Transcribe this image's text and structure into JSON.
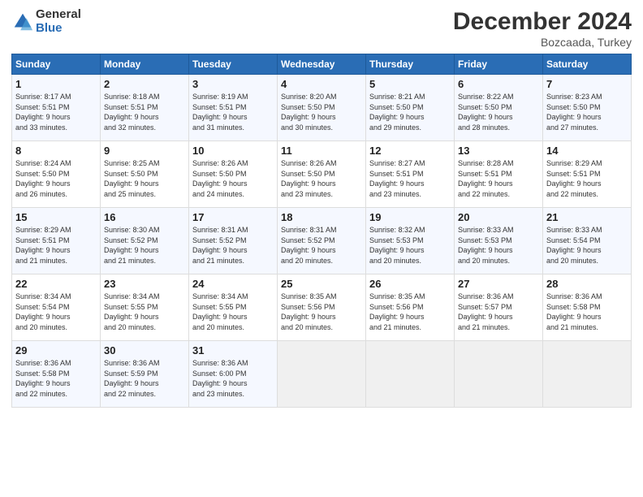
{
  "header": {
    "logo_general": "General",
    "logo_blue": "Blue",
    "title": "December 2024",
    "location": "Bozcaada, Turkey"
  },
  "columns": [
    "Sunday",
    "Monday",
    "Tuesday",
    "Wednesday",
    "Thursday",
    "Friday",
    "Saturday"
  ],
  "weeks": [
    {
      "cells": [
        {
          "day": "1",
          "info": "Sunrise: 8:17 AM\nSunset: 5:51 PM\nDaylight: 9 hours\nand 33 minutes."
        },
        {
          "day": "2",
          "info": "Sunrise: 8:18 AM\nSunset: 5:51 PM\nDaylight: 9 hours\nand 32 minutes."
        },
        {
          "day": "3",
          "info": "Sunrise: 8:19 AM\nSunset: 5:51 PM\nDaylight: 9 hours\nand 31 minutes."
        },
        {
          "day": "4",
          "info": "Sunrise: 8:20 AM\nSunset: 5:50 PM\nDaylight: 9 hours\nand 30 minutes."
        },
        {
          "day": "5",
          "info": "Sunrise: 8:21 AM\nSunset: 5:50 PM\nDaylight: 9 hours\nand 29 minutes."
        },
        {
          "day": "6",
          "info": "Sunrise: 8:22 AM\nSunset: 5:50 PM\nDaylight: 9 hours\nand 28 minutes."
        },
        {
          "day": "7",
          "info": "Sunrise: 8:23 AM\nSunset: 5:50 PM\nDaylight: 9 hours\nand 27 minutes."
        }
      ]
    },
    {
      "cells": [
        {
          "day": "8",
          "info": "Sunrise: 8:24 AM\nSunset: 5:50 PM\nDaylight: 9 hours\nand 26 minutes."
        },
        {
          "day": "9",
          "info": "Sunrise: 8:25 AM\nSunset: 5:50 PM\nDaylight: 9 hours\nand 25 minutes."
        },
        {
          "day": "10",
          "info": "Sunrise: 8:26 AM\nSunset: 5:50 PM\nDaylight: 9 hours\nand 24 minutes."
        },
        {
          "day": "11",
          "info": "Sunrise: 8:26 AM\nSunset: 5:50 PM\nDaylight: 9 hours\nand 23 minutes."
        },
        {
          "day": "12",
          "info": "Sunrise: 8:27 AM\nSunset: 5:51 PM\nDaylight: 9 hours\nand 23 minutes."
        },
        {
          "day": "13",
          "info": "Sunrise: 8:28 AM\nSunset: 5:51 PM\nDaylight: 9 hours\nand 22 minutes."
        },
        {
          "day": "14",
          "info": "Sunrise: 8:29 AM\nSunset: 5:51 PM\nDaylight: 9 hours\nand 22 minutes."
        }
      ]
    },
    {
      "cells": [
        {
          "day": "15",
          "info": "Sunrise: 8:29 AM\nSunset: 5:51 PM\nDaylight: 9 hours\nand 21 minutes."
        },
        {
          "day": "16",
          "info": "Sunrise: 8:30 AM\nSunset: 5:52 PM\nDaylight: 9 hours\nand 21 minutes."
        },
        {
          "day": "17",
          "info": "Sunrise: 8:31 AM\nSunset: 5:52 PM\nDaylight: 9 hours\nand 21 minutes."
        },
        {
          "day": "18",
          "info": "Sunrise: 8:31 AM\nSunset: 5:52 PM\nDaylight: 9 hours\nand 20 minutes."
        },
        {
          "day": "19",
          "info": "Sunrise: 8:32 AM\nSunset: 5:53 PM\nDaylight: 9 hours\nand 20 minutes."
        },
        {
          "day": "20",
          "info": "Sunrise: 8:33 AM\nSunset: 5:53 PM\nDaylight: 9 hours\nand 20 minutes."
        },
        {
          "day": "21",
          "info": "Sunrise: 8:33 AM\nSunset: 5:54 PM\nDaylight: 9 hours\nand 20 minutes."
        }
      ]
    },
    {
      "cells": [
        {
          "day": "22",
          "info": "Sunrise: 8:34 AM\nSunset: 5:54 PM\nDaylight: 9 hours\nand 20 minutes."
        },
        {
          "day": "23",
          "info": "Sunrise: 8:34 AM\nSunset: 5:55 PM\nDaylight: 9 hours\nand 20 minutes."
        },
        {
          "day": "24",
          "info": "Sunrise: 8:34 AM\nSunset: 5:55 PM\nDaylight: 9 hours\nand 20 minutes."
        },
        {
          "day": "25",
          "info": "Sunrise: 8:35 AM\nSunset: 5:56 PM\nDaylight: 9 hours\nand 20 minutes."
        },
        {
          "day": "26",
          "info": "Sunrise: 8:35 AM\nSunset: 5:56 PM\nDaylight: 9 hours\nand 21 minutes."
        },
        {
          "day": "27",
          "info": "Sunrise: 8:36 AM\nSunset: 5:57 PM\nDaylight: 9 hours\nand 21 minutes."
        },
        {
          "day": "28",
          "info": "Sunrise: 8:36 AM\nSunset: 5:58 PM\nDaylight: 9 hours\nand 21 minutes."
        }
      ]
    },
    {
      "cells": [
        {
          "day": "29",
          "info": "Sunrise: 8:36 AM\nSunset: 5:58 PM\nDaylight: 9 hours\nand 22 minutes."
        },
        {
          "day": "30",
          "info": "Sunrise: 8:36 AM\nSunset: 5:59 PM\nDaylight: 9 hours\nand 22 minutes."
        },
        {
          "day": "31",
          "info": "Sunrise: 8:36 AM\nSunset: 6:00 PM\nDaylight: 9 hours\nand 23 minutes."
        },
        {
          "day": "",
          "info": ""
        },
        {
          "day": "",
          "info": ""
        },
        {
          "day": "",
          "info": ""
        },
        {
          "day": "",
          "info": ""
        }
      ]
    }
  ]
}
